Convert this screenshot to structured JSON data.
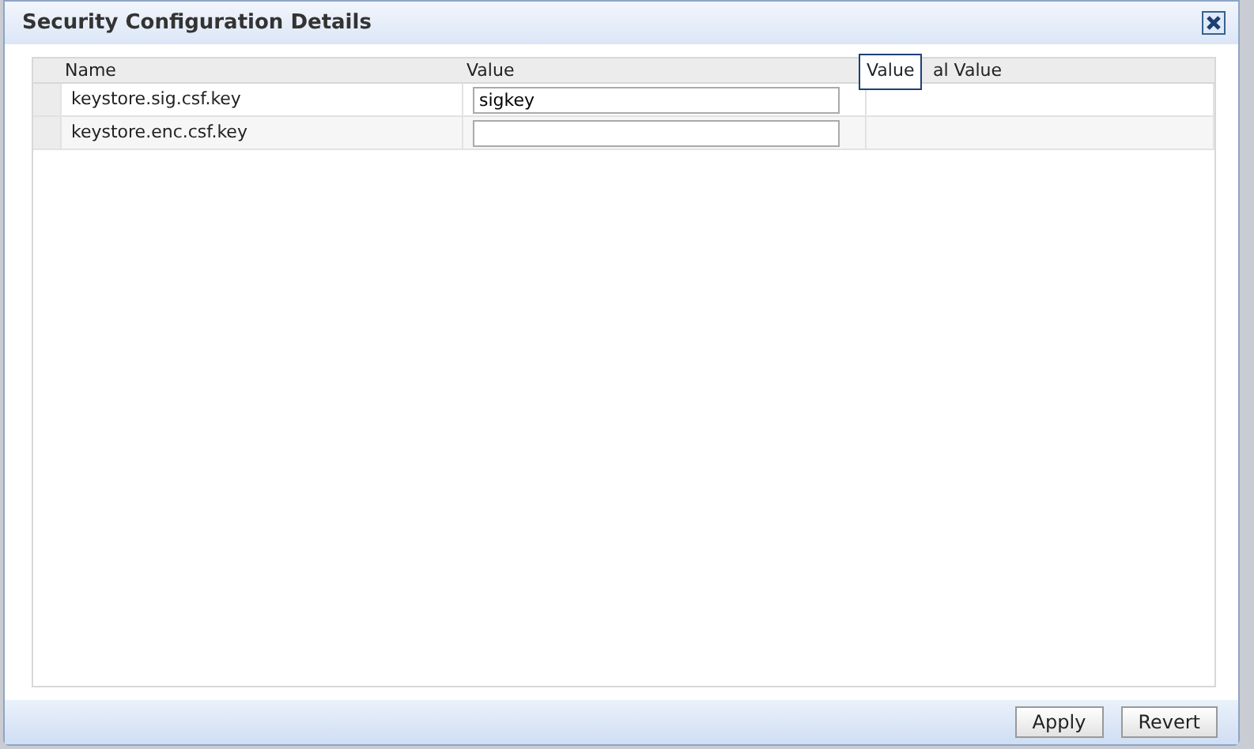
{
  "dialog": {
    "title": "Security Configuration Details"
  },
  "table": {
    "columns": [
      "Name",
      "Value",
      "al Value"
    ],
    "rows": [
      {
        "name": "keystore.sig.csf.key",
        "value": "sigkey"
      },
      {
        "name": "keystore.enc.csf.key",
        "value": ""
      }
    ]
  },
  "tooltip": "Value",
  "buttons": [
    "Apply",
    "Revert"
  ]
}
